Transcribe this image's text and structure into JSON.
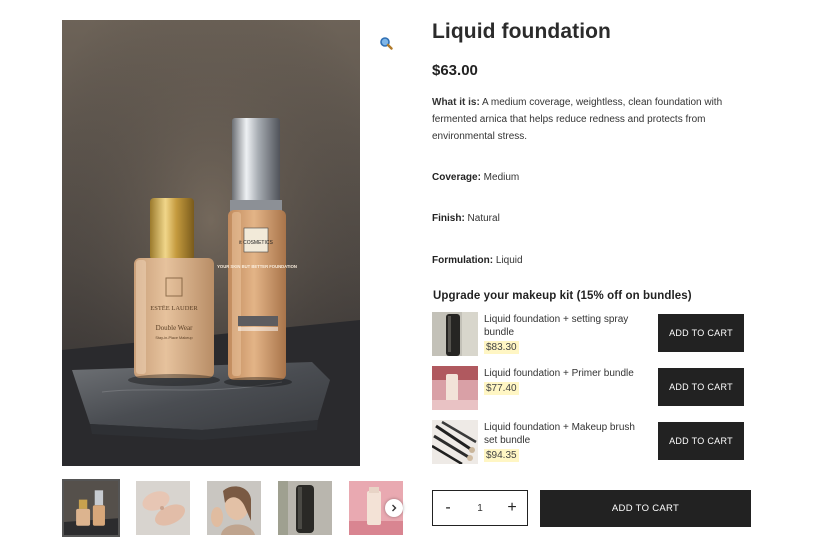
{
  "product": {
    "title": "Liquid foundation",
    "price": "$63.00",
    "description_label": "What it is:",
    "description": " A medium coverage, weightless, clean foundation with fermented arnica that helps reduce redness and protects from environmental stress.",
    "attributes": [
      {
        "label": "Coverage:",
        "value": " Medium"
      },
      {
        "label": "Finish:",
        "value": " Natural"
      },
      {
        "label": "Formulation:",
        "value": " Liquid"
      }
    ]
  },
  "gallery": {
    "main_image": {
      "left_bottle_brand": "ESTĒE LAUDER",
      "left_bottle_name": "Double Wear",
      "left_bottle_sub": "Stay-in-Place Makeup",
      "right_bottle_brand": "it COSMETICS",
      "right_bottle_text": "YOUR SKIN BUT BETTER FOUNDATION"
    },
    "zoom_icon": "magnifier-icon",
    "thumbnail_count": 5,
    "next_icon": "chevron-right-icon"
  },
  "bundles": {
    "heading": "Upgrade your makeup kit (15% off on bundles)",
    "items": [
      {
        "name": "Liquid foundation + setting spray bundle",
        "price": "$83.30",
        "button": "ADD TO CART"
      },
      {
        "name": "Liquid foundation + Primer bundle",
        "price": "$77.40",
        "button": "ADD TO CART"
      },
      {
        "name": "Liquid foundation + Makeup brush set bundle",
        "price": "$94.35",
        "button": "ADD TO CART"
      }
    ]
  },
  "purchase": {
    "minus": "-",
    "quantity": "1",
    "plus": "+",
    "add_to_cart": "ADD TO CART"
  },
  "colors": {
    "button_bg": "#222222",
    "price_highlight": "#fff6c4",
    "text": "#2b2b2b"
  }
}
